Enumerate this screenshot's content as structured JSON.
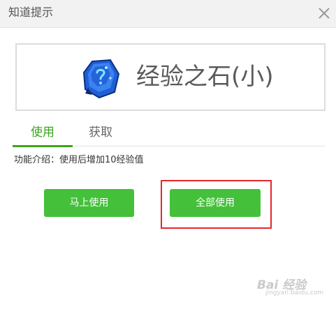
{
  "dialog": {
    "title": "知道提示",
    "close_icon": "close-icon"
  },
  "item": {
    "name": "经验之石(小)",
    "icon": "experience-stone-icon",
    "icon_color": "#1f5fd6"
  },
  "tabs": [
    {
      "label": "使用",
      "active": true
    },
    {
      "label": "获取",
      "active": false
    }
  ],
  "description": "功能介绍：使用后增加10经验值",
  "buttons": {
    "use_now": "马上使用",
    "use_all": "全部使用"
  },
  "colors": {
    "accent": "#3aa51c",
    "button": "#44c03a",
    "highlight": "#e5262c"
  },
  "watermark": {
    "text": "Bai 经验",
    "sub": "jingyan.baidu.com"
  }
}
